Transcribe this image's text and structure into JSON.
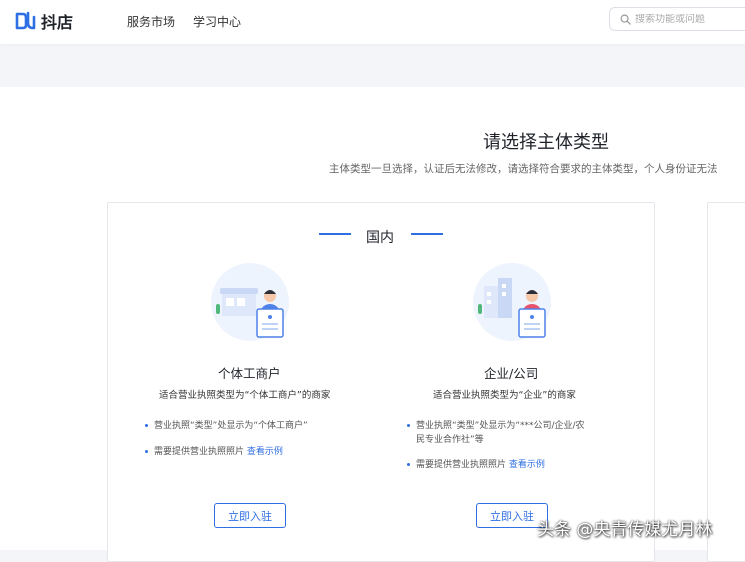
{
  "header": {
    "logo_text": "抖店",
    "nav": [
      "服务市场",
      "学习中心"
    ],
    "search_placeholder": "搜索功能或问题"
  },
  "page": {
    "title": "请选择主体类型",
    "subtitle": "主体类型一旦选择，认证后无法修改，请选择符合要求的主体类型，个人身份证无法"
  },
  "domestic": {
    "label": "国内",
    "types": [
      {
        "title": "个体工商户",
        "desc": "适合营业执照类型为“个体工商户”的商家",
        "bullet1": "营业执照“类型”处显示为“个体工商户”",
        "bullet2_text": "需要提供营业执照照片 ",
        "bullet2_link": "查看示例",
        "button": "立即入驻"
      },
      {
        "title": "企业/公司",
        "desc": "适合营业执照类型为“企业”的商家",
        "bullet1_line1": "营业执照“类型”处显示为“***公司/企业/农",
        "bullet1_line2": "民专业合作社”等",
        "bullet2_text": "需要提供营业执照照片 ",
        "bullet2_link": "查看示例",
        "button": "立即入驻"
      }
    ]
  },
  "watermark": "头条 @央青传媒尤月林",
  "colors": {
    "accent": "#2f6fe4",
    "background": "#f4f5f8"
  }
}
